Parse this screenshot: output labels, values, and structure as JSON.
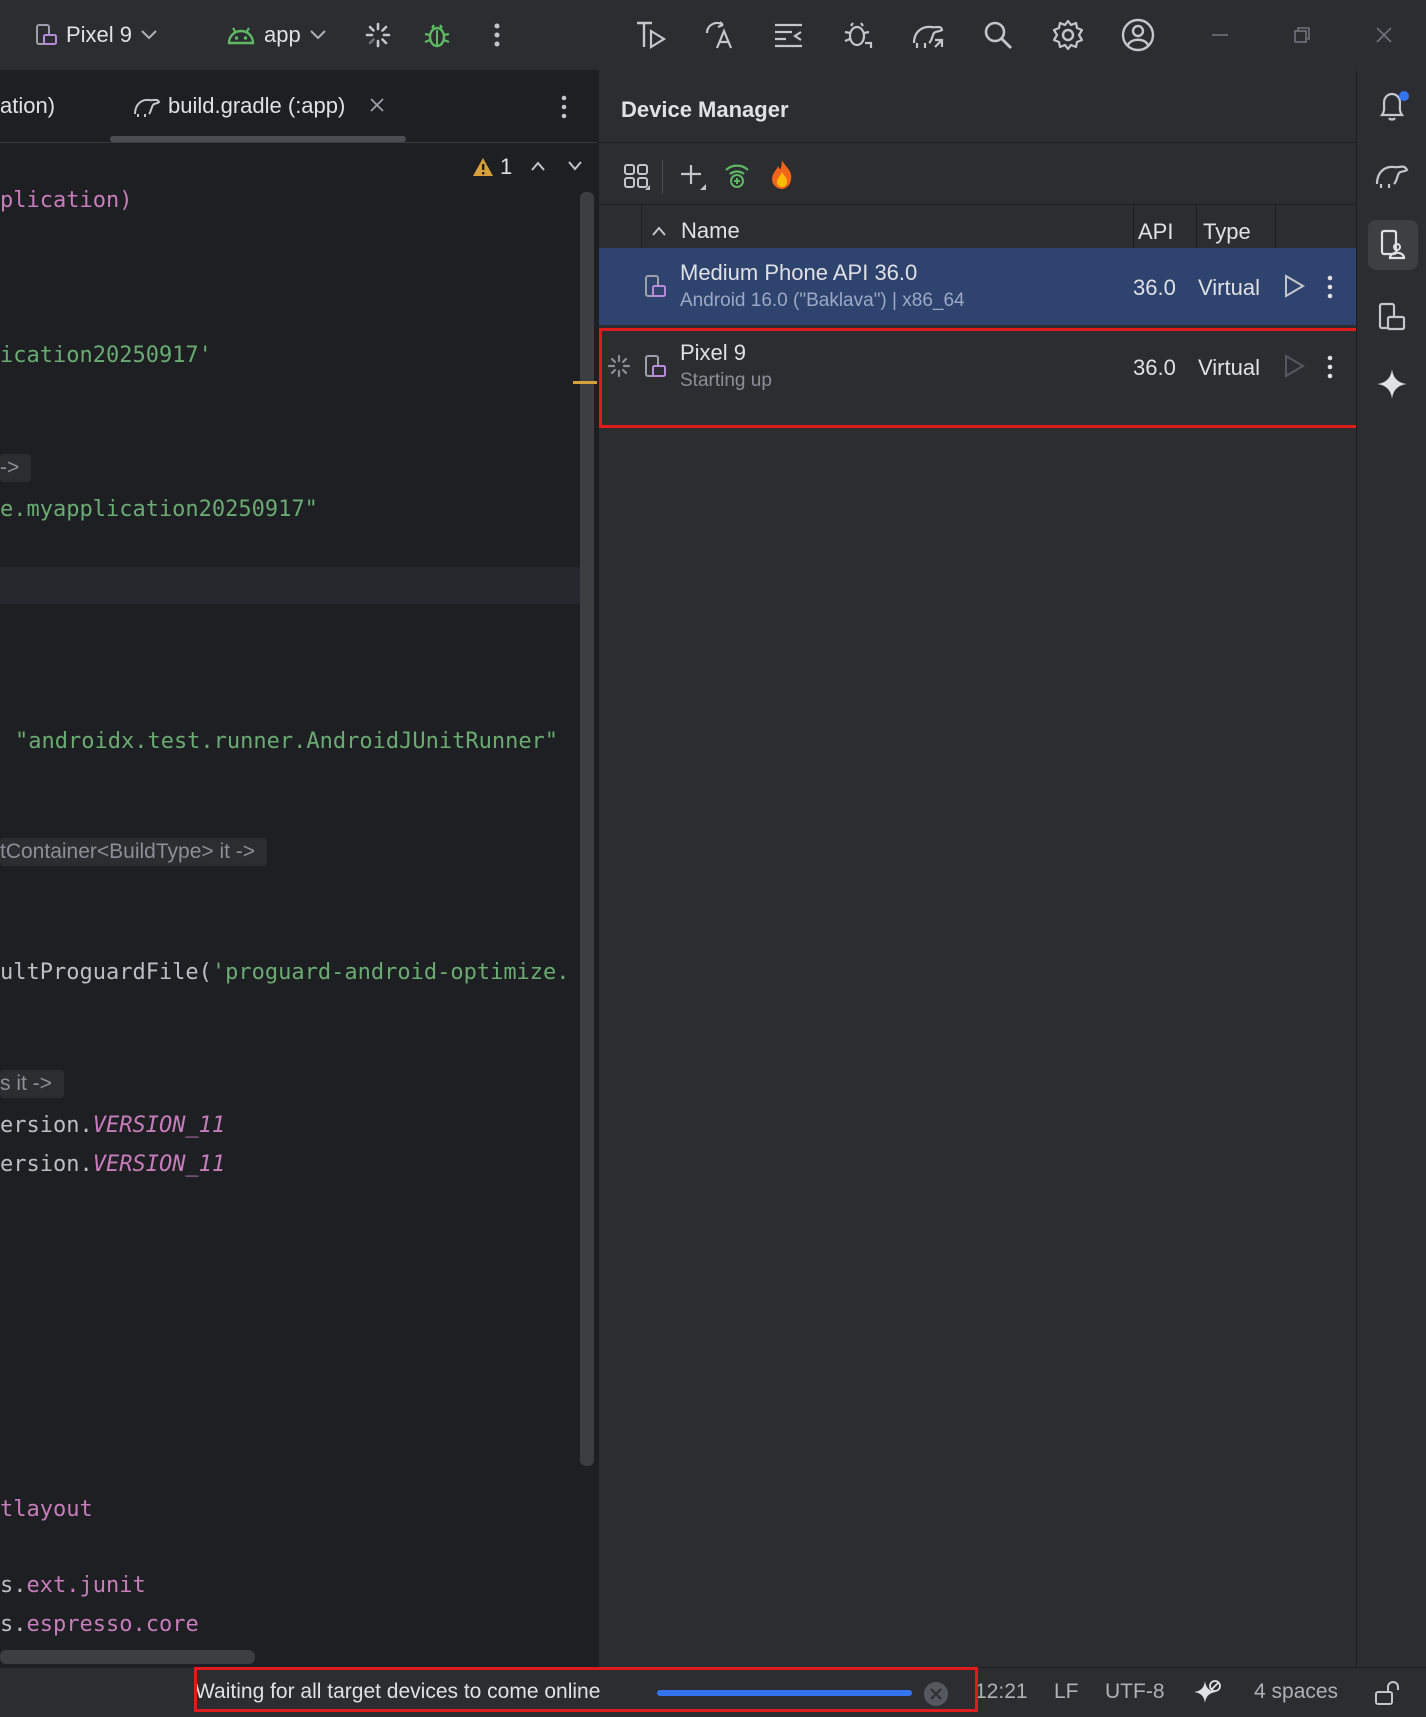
{
  "toolbar": {
    "device_label": "Pixel 9",
    "config_label": "app"
  },
  "editor": {
    "tabs": [
      {
        "label": "ation)"
      },
      {
        "label": "build.gradle (:app)"
      }
    ],
    "warnings_count": "1",
    "code": {
      "l1": "plication)",
      "l2": "ication20250917'",
      "l3_hint": "->",
      "l4": "e.myapplication20250917\"",
      "l5": "\"androidx.test.runner.AndroidJUnitRunner\"",
      "l6_hint": "tContainer<BuildType> it ->",
      "l7_a": "ultProguardFile(",
      "l7_b": "'proguard-android-optimize.",
      "l8_hint": "s it ->",
      "l9_a": "ersion.",
      "l9_b": "VERSION_11",
      "l10_a": "ersion.",
      "l10_b": "VERSION_11",
      "l11": "tlayout",
      "l12_a": "s.",
      "l12_b": "ext.junit",
      "l13_a": "s.",
      "l13_b": "espresso.core"
    }
  },
  "device_manager": {
    "title": "Device Manager",
    "columns": {
      "name": "Name",
      "api": "API",
      "type": "Type"
    },
    "devices": [
      {
        "name": "Medium Phone API 36.0",
        "subtitle": "Android 16.0 (\"Baklava\") | x86_64",
        "api": "36.0",
        "type": "Virtual",
        "selected": true
      },
      {
        "name": "Pixel 9",
        "subtitle": "Starting up",
        "api": "36.0",
        "type": "Virtual",
        "selected": false
      }
    ]
  },
  "statusbar": {
    "task_message": "Waiting for all target devices to come online",
    "progress": 1.0,
    "position": "12:21",
    "line_separator": "LF",
    "encoding": "UTF-8",
    "indent": "4 spaces"
  },
  "colors": {
    "accent": "#3574f0",
    "selected_row": "#2e436e",
    "highlight_box": "#e01b1b",
    "string": "#6aab73",
    "keyword": "#c77dbb"
  }
}
